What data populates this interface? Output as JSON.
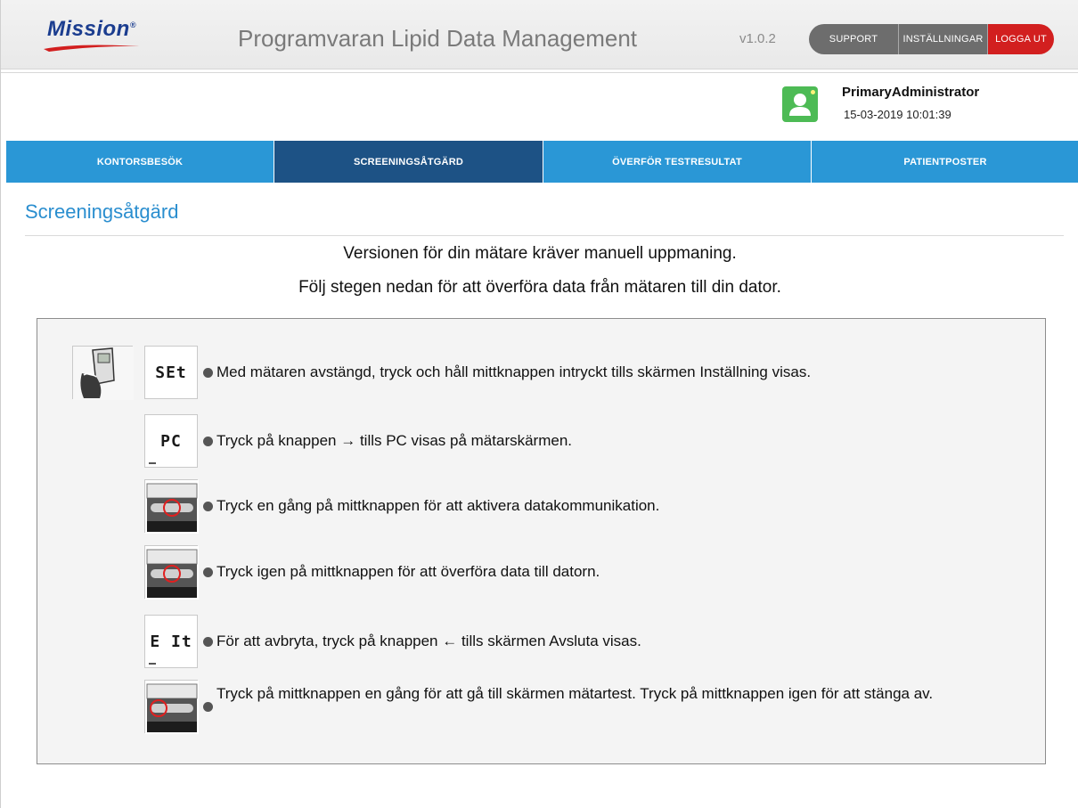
{
  "header": {
    "logo_text": "Mission",
    "logo_mark": "®",
    "app_title": "Programvaran Lipid Data Management",
    "version": "v1.0.2",
    "buttons": {
      "support": "SUPPORT",
      "settings": "INSTÄLLNINGAR",
      "logout": "LOGGA UT"
    }
  },
  "user": {
    "name": "PrimaryAdministrator",
    "datetime": "15-03-2019 10:01:39",
    "avatar_icon": "user-avatar-icon"
  },
  "nav": {
    "tabs": [
      {
        "label": "KONTORSBESÖK",
        "active": false
      },
      {
        "label": "SCREENINGSÅTGÄRD",
        "active": true
      },
      {
        "label": "ÖVERFÖR TESTRESULTAT",
        "active": false
      },
      {
        "label": "PATIENTPOSTER",
        "active": false
      }
    ]
  },
  "main": {
    "title": "Screeningsåtgärd",
    "instruction_line1": "Versionen för din mätare kräver manuell uppmaning.",
    "instruction_line2": "Följ stegen nedan för att överföra data från mätaren till din dator.",
    "steps": [
      {
        "lcd": "SEt",
        "text": "Med mätaren avstängd, tryck och håll mittknappen intryckt tills skärmen Inställning visas."
      },
      {
        "lcd": "PC",
        "text": "Tryck på knappen → tills PC visas på mätarskärmen."
      },
      {
        "image": "meter-center-button-icon",
        "text": "Tryck en gång på mittknappen för att aktivera datakommunikation."
      },
      {
        "image": "meter-center-button-icon",
        "text": "Tryck igen på mittknappen för att överföra data till datorn."
      },
      {
        "lcd": "E It",
        "text": "För att avbryta, tryck på knappen ← tills skärmen Avsluta visas."
      },
      {
        "image": "meter-left-button-icon",
        "text": "Tryck på mittknappen en gång för att gå till skärmen mätartest. Tryck på mittknappen igen för att stänga av."
      }
    ]
  },
  "colors": {
    "nav_blue": "#2a97d6",
    "nav_active": "#1d5285",
    "title_blue": "#2a8ecf",
    "logout_red": "#d21f1f",
    "avatar_green": "#4dbb55"
  }
}
